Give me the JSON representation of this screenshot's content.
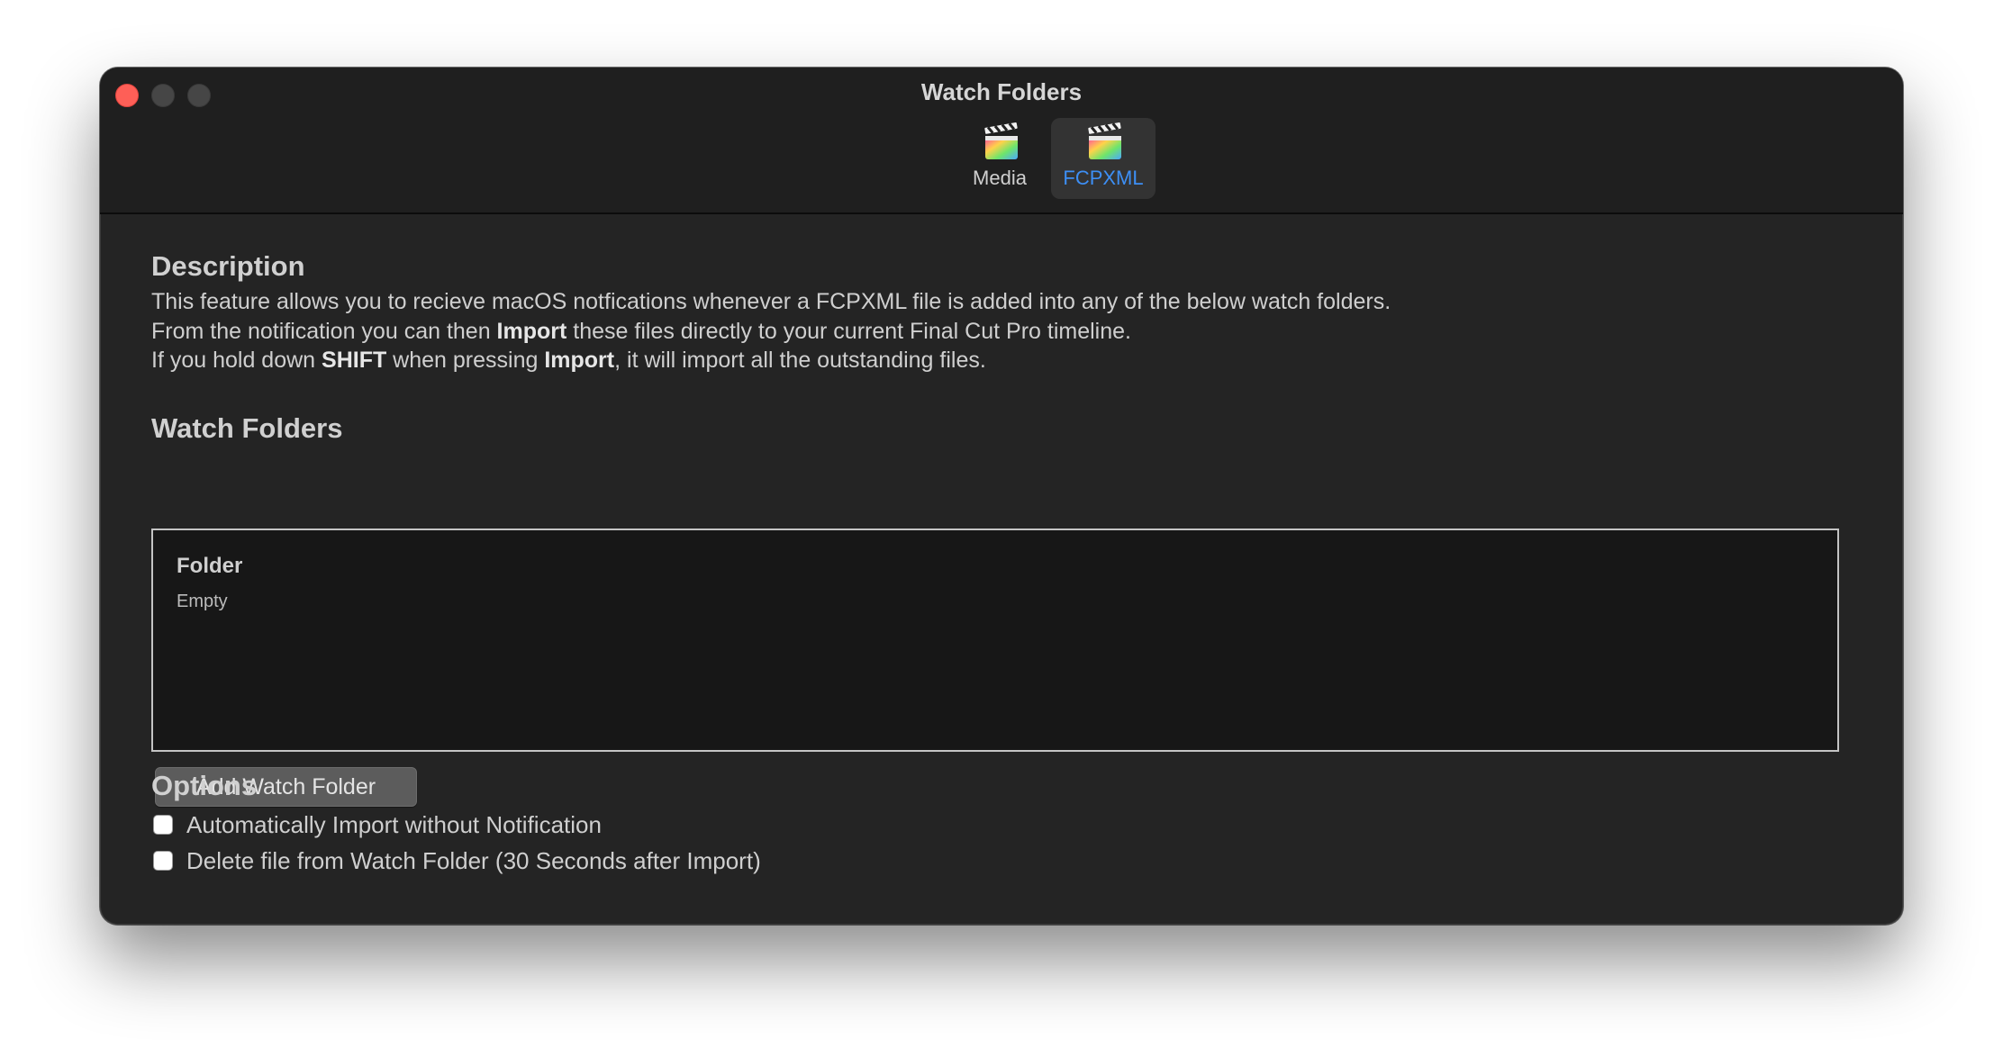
{
  "window": {
    "title": "Watch Folders"
  },
  "toolbar": {
    "tabs": [
      {
        "label": "Media",
        "icon": "final-cut-pro-icon",
        "active": false
      },
      {
        "label": "FCPXML",
        "icon": "final-cut-pro-icon",
        "active": true
      }
    ]
  },
  "description": {
    "title": "Description",
    "line1": "This feature allows you to recieve macOS notfications whenever a FCPXML file is added into any of the below watch folders.",
    "line2_a": "From the notification you can then ",
    "line2_b": "Import",
    "line2_c": " these files directly to your current Final Cut Pro timeline.",
    "line3_a": "If you hold down ",
    "line3_b": "SHIFT",
    "line3_c": " when pressing ",
    "line3_d": "Import",
    "line3_e": ", it will import all the outstanding files."
  },
  "watch_folders": {
    "title": "Watch Folders",
    "column_header": "Folder",
    "empty_text": "Empty",
    "add_button": "Add Watch Folder"
  },
  "options": {
    "title": "Options",
    "items": [
      {
        "label": "Automatically Import without Notification",
        "checked": false
      },
      {
        "label": "Delete file from Watch Folder (30 Seconds after Import)",
        "checked": false
      }
    ]
  },
  "colors": {
    "close": "#fe5f57",
    "accent": "#3d8ff5",
    "window_bg": "#242424"
  }
}
